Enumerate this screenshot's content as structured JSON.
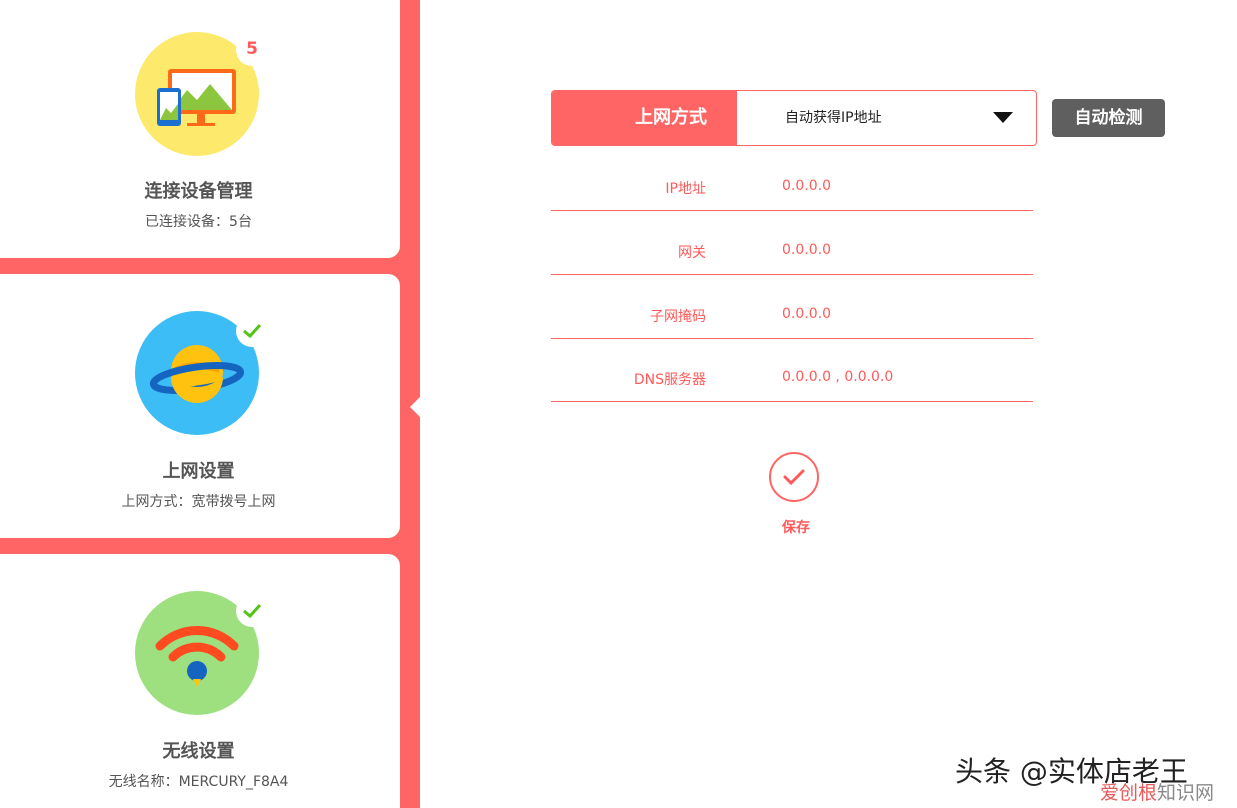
{
  "sidebar": {
    "cards": [
      {
        "title": "连接设备管理",
        "subtitle": "已连接设备：5台",
        "badge": "5",
        "icon": "devices-icon",
        "color": "#fde96b"
      },
      {
        "title": "上网设置",
        "subtitle": "上网方式：宽带拨号上网",
        "icon": "planet-icon",
        "color": "#3cbdf5"
      },
      {
        "title": "无线设置",
        "subtitle": "无线名称：MERCURY_F8A4",
        "icon": "wifi-icon",
        "color": "#9ee07f"
      }
    ]
  },
  "form": {
    "mode_label": "上网方式",
    "mode_value": "自动获得IP地址",
    "detect_button": "自动检测",
    "fields": [
      {
        "label": "IP地址",
        "value": "0.0.0.0"
      },
      {
        "label": "网关",
        "value": "0.0.0.0"
      },
      {
        "label": "子网掩码",
        "value": "0.0.0.0"
      },
      {
        "label": "DNS服务器",
        "value": "0.0.0.0 , 0.0.0.0"
      }
    ],
    "save_label": "保存"
  },
  "watermark": {
    "main": "头条 @实体店老王",
    "sub_red": "爱创根",
    "sub": "知识网"
  },
  "colors": {
    "accent": "#ff6564",
    "button_dark": "#5f5f5f"
  }
}
